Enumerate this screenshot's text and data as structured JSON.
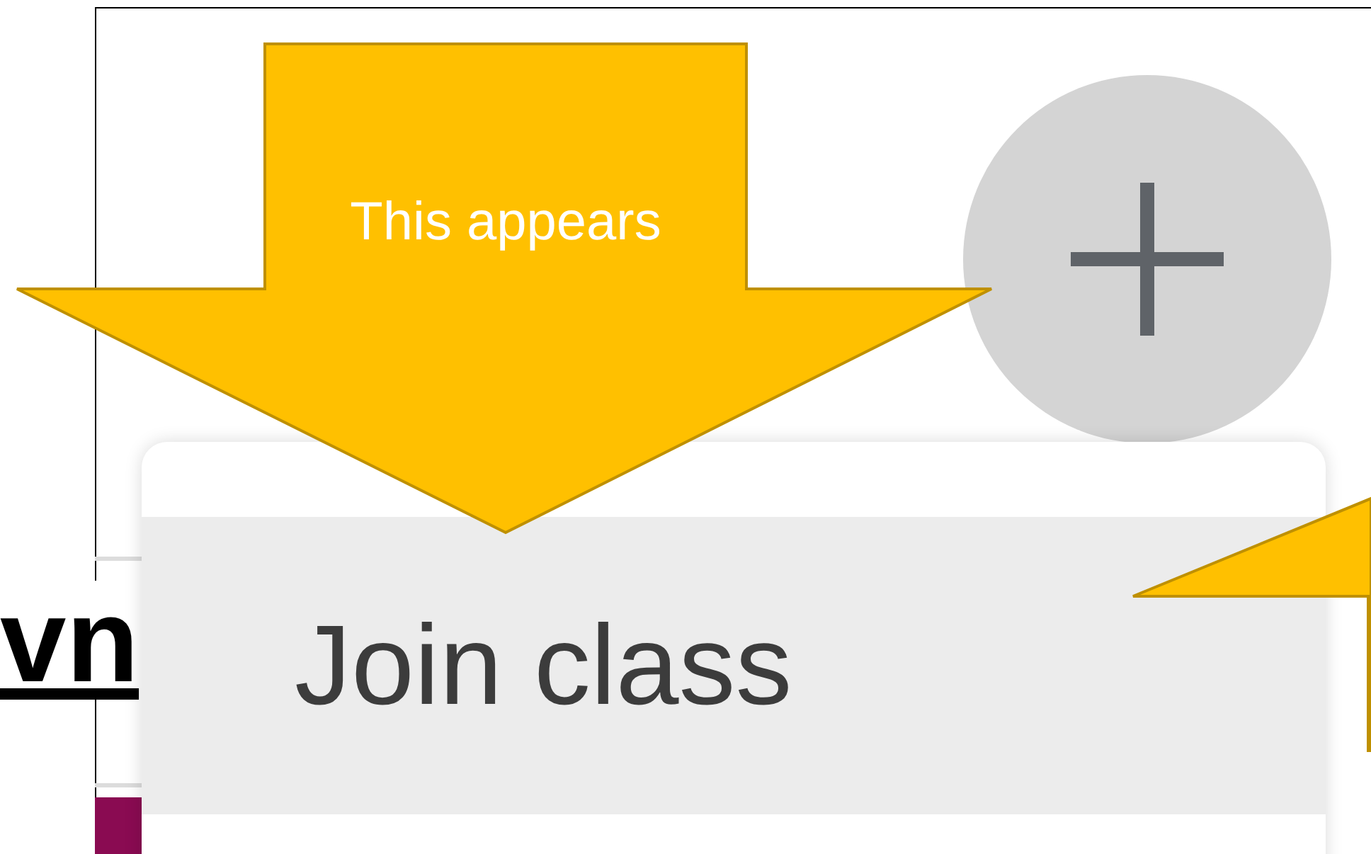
{
  "page_fragment": {
    "text": "vn"
  },
  "menu": {
    "items": [
      {
        "label": "Join class",
        "selected": true
      }
    ]
  },
  "callout": {
    "text": "This appears"
  }
}
